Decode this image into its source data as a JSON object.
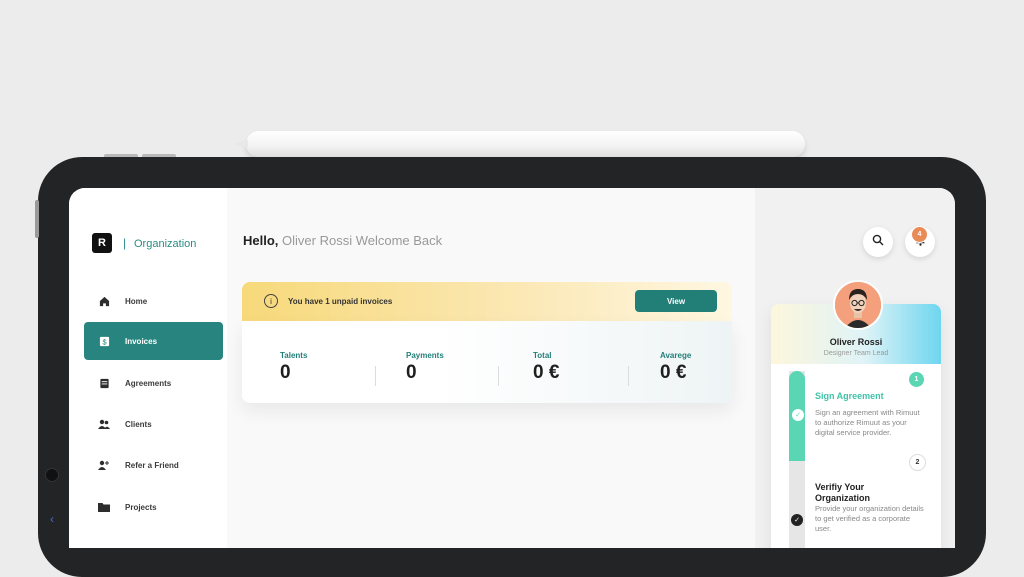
{
  "sidebar": {
    "brand": "Organization",
    "logo_glyph": "R",
    "items": [
      {
        "label": "Home",
        "icon": "home-icon"
      },
      {
        "label": "Invoices",
        "icon": "invoice-icon"
      },
      {
        "label": "Agreements",
        "icon": "agreement-icon"
      },
      {
        "label": "Clients",
        "icon": "clients-icon"
      },
      {
        "label": "Refer a Friend",
        "icon": "refer-icon"
      },
      {
        "label": "Projects",
        "icon": "folder-icon"
      }
    ],
    "active_item": "Invoices"
  },
  "header": {
    "greeting_bold": "Hello,",
    "greeting_rest": " Oliver Rossi Welcome Back"
  },
  "alert": {
    "text": "You have 1 unpaid invoices",
    "button": "View"
  },
  "stats": [
    {
      "label": "Talents",
      "value": "0"
    },
    {
      "label": "Payments",
      "value": "0"
    },
    {
      "label": "Total",
      "value": "0 €"
    },
    {
      "label": "Avarege",
      "value": "0 €"
    }
  ],
  "notifications": {
    "count": "4"
  },
  "profile": {
    "name": "Oliver Rossi",
    "role": "Designer Team Lead"
  },
  "steps": [
    {
      "num": "1",
      "title": "Sign Agreement",
      "desc": "Sign an agreement with Rimuut to authorize Rimuut as your digital service provider."
    },
    {
      "num": "2",
      "title": "Verifiy Your Organization",
      "desc": "Provide your organization details to get verified as a corporate user."
    }
  ],
  "colors": {
    "accent": "#27847e",
    "step_active": "#5ad6b5",
    "badge": "#e98b57"
  }
}
